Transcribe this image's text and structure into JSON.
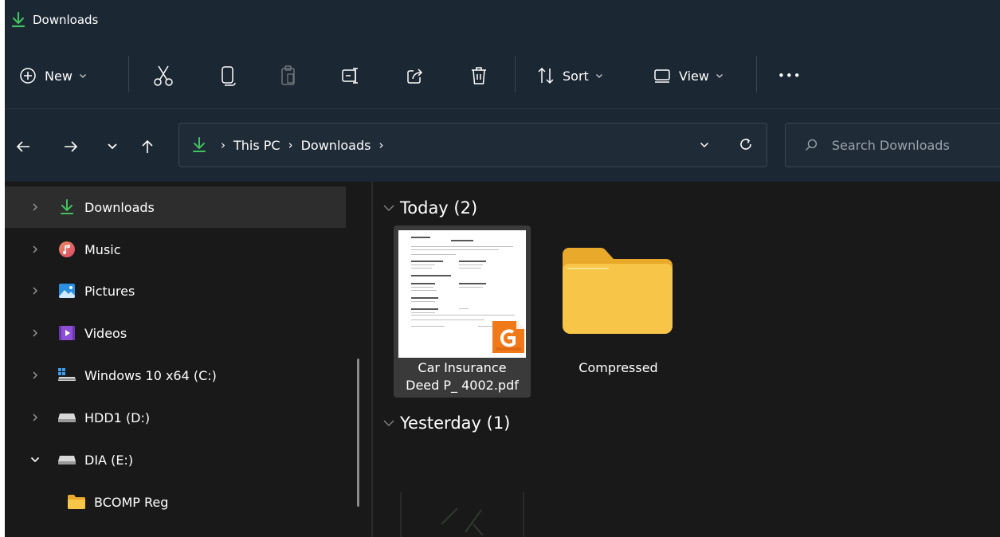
{
  "window": {
    "title": "Downloads"
  },
  "commandbar": {
    "new_label": "New",
    "sort_label": "Sort",
    "view_label": "View",
    "more_label": "•••",
    "icons": [
      "add-icon",
      "cut-icon",
      "copy-icon",
      "paste-icon",
      "rename-icon",
      "share-icon",
      "delete-icon",
      "sort-icon",
      "view-icon"
    ]
  },
  "address": {
    "crumbs": [
      "This PC",
      "Downloads"
    ],
    "separator": "›"
  },
  "search": {
    "placeholder": "Search Downloads"
  },
  "sidebar": {
    "items": [
      {
        "label": "Downloads",
        "icon": "download-icon",
        "expanded": false,
        "selected": true
      },
      {
        "label": "Music",
        "icon": "music-icon",
        "expanded": false
      },
      {
        "label": "Pictures",
        "icon": "pictures-icon",
        "expanded": false
      },
      {
        "label": "Videos",
        "icon": "videos-icon",
        "expanded": false
      },
      {
        "label": "Windows 10 x64 (C:)",
        "icon": "windows-drive-icon",
        "expanded": false
      },
      {
        "label": "HDD1 (D:)",
        "icon": "drive-icon",
        "expanded": false
      },
      {
        "label": "DIA (E:)",
        "icon": "drive-icon",
        "expanded": true
      },
      {
        "label": "BCOMP Reg",
        "icon": "folder-icon"
      }
    ]
  },
  "content": {
    "groups": [
      {
        "label": "Today (2)"
      },
      {
        "label": "Yesterday (1)"
      }
    ],
    "files": [
      {
        "name_line1": "Car Insurance",
        "name_line2": "Deed P_ 4002.pdf",
        "type": "pdf",
        "selected": true
      },
      {
        "name": "Compressed",
        "type": "folder"
      }
    ]
  },
  "colors": {
    "chrome": "#1b2733",
    "background": "#191919",
    "accent_green": "#3fc35d",
    "folder_yellow": "#f7c648",
    "pdf_orange": "#f07a1a"
  }
}
